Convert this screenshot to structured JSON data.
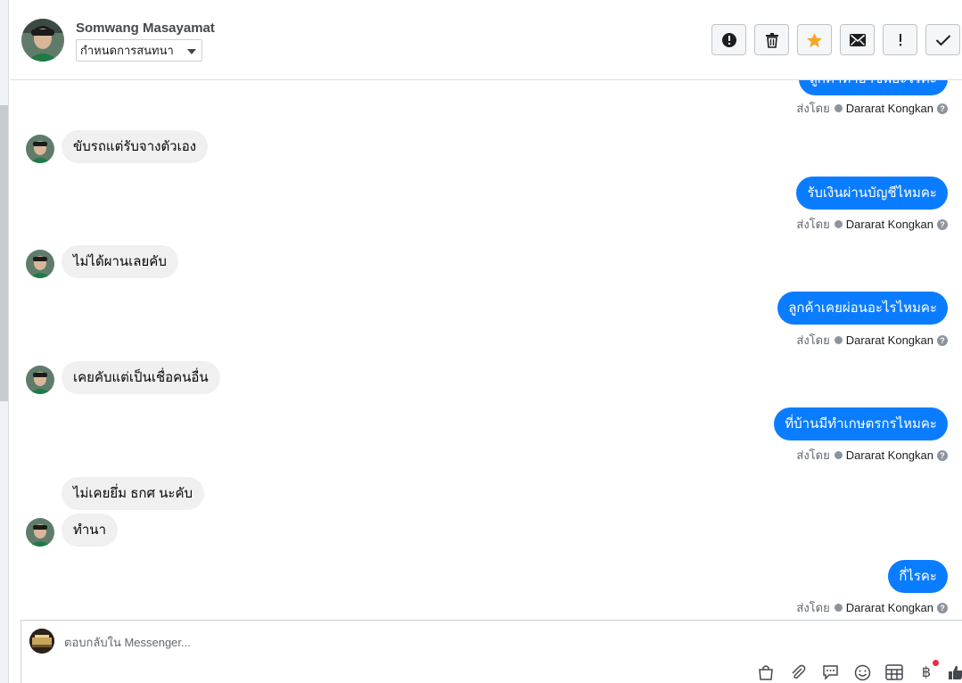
{
  "header": {
    "contact_name": "Somwang Masayamat",
    "assign_label": "กำหนดการสนทนา"
  },
  "toolbar": {
    "buttons": [
      "report",
      "delete",
      "star",
      "mark-unread",
      "important",
      "done"
    ],
    "star_color": "#f5a623"
  },
  "thread": {
    "sent_by_label": "ส่งโดย",
    "agent_name": "Dararat Kongkan",
    "messages": [
      {
        "dir": "out",
        "text": "ลูกค้าทำอาชีพอะไรคะ"
      },
      {
        "dir": "in",
        "text": "ขับรถแต่รับจางตัวเอง"
      },
      {
        "dir": "out",
        "text": "รับเงินผ่านบัญชีไหมคะ"
      },
      {
        "dir": "in",
        "text": "ไม่ได้ผานเลยคับ"
      },
      {
        "dir": "out",
        "text": "ลูกค้าเคยผ่อนอะไรไหมคะ"
      },
      {
        "dir": "in",
        "text": "เคยคับแต่เป็นเชื่อคนอื่น"
      },
      {
        "dir": "out",
        "text": "ที่บ้านมีทำเกษตรกรไหมคะ"
      },
      {
        "dir": "in",
        "text": "ไม่เคยยึ่ม ธกศ นะคับ"
      },
      {
        "dir": "in",
        "text": "ทำนา"
      },
      {
        "dir": "out",
        "text": "กี่ไรคะ"
      }
    ],
    "bubble_out_color": "#0a7cff",
    "bubble_in_color": "#f0f0f0"
  },
  "composer": {
    "placeholder": "ตอบกลับใน Messenger...",
    "icons": [
      "bag-icon",
      "attachment-icon",
      "saved-reply-icon",
      "emoji-icon",
      "template-icon",
      "payment-icon",
      "like-icon"
    ]
  }
}
